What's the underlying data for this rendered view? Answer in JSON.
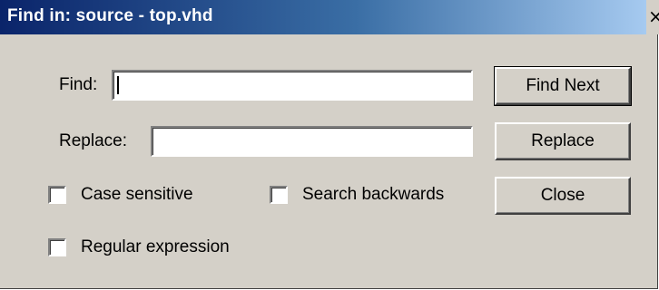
{
  "window": {
    "title": "Find in: source - top.vhd",
    "close_glyph": "×"
  },
  "find": {
    "label": "Find:",
    "value": ""
  },
  "replace": {
    "label": "Replace:",
    "value": ""
  },
  "options": {
    "case_sensitive": {
      "label": "Case sensitive",
      "checked": false
    },
    "search_backwards": {
      "label": "Search backwards",
      "checked": false
    },
    "regular_expression": {
      "label": "Regular expression",
      "checked": false
    }
  },
  "buttons": {
    "find_next": "Find Next",
    "replace": "Replace",
    "close": "Close"
  },
  "colors": {
    "dialog_face": "#d4d0c8",
    "title_gradient_start": "#0a246a",
    "title_gradient_end": "#a6caf0",
    "title_text": "#ffffff"
  },
  "icons": {
    "close": "close-icon",
    "checkbox": "checkbox-unchecked"
  }
}
